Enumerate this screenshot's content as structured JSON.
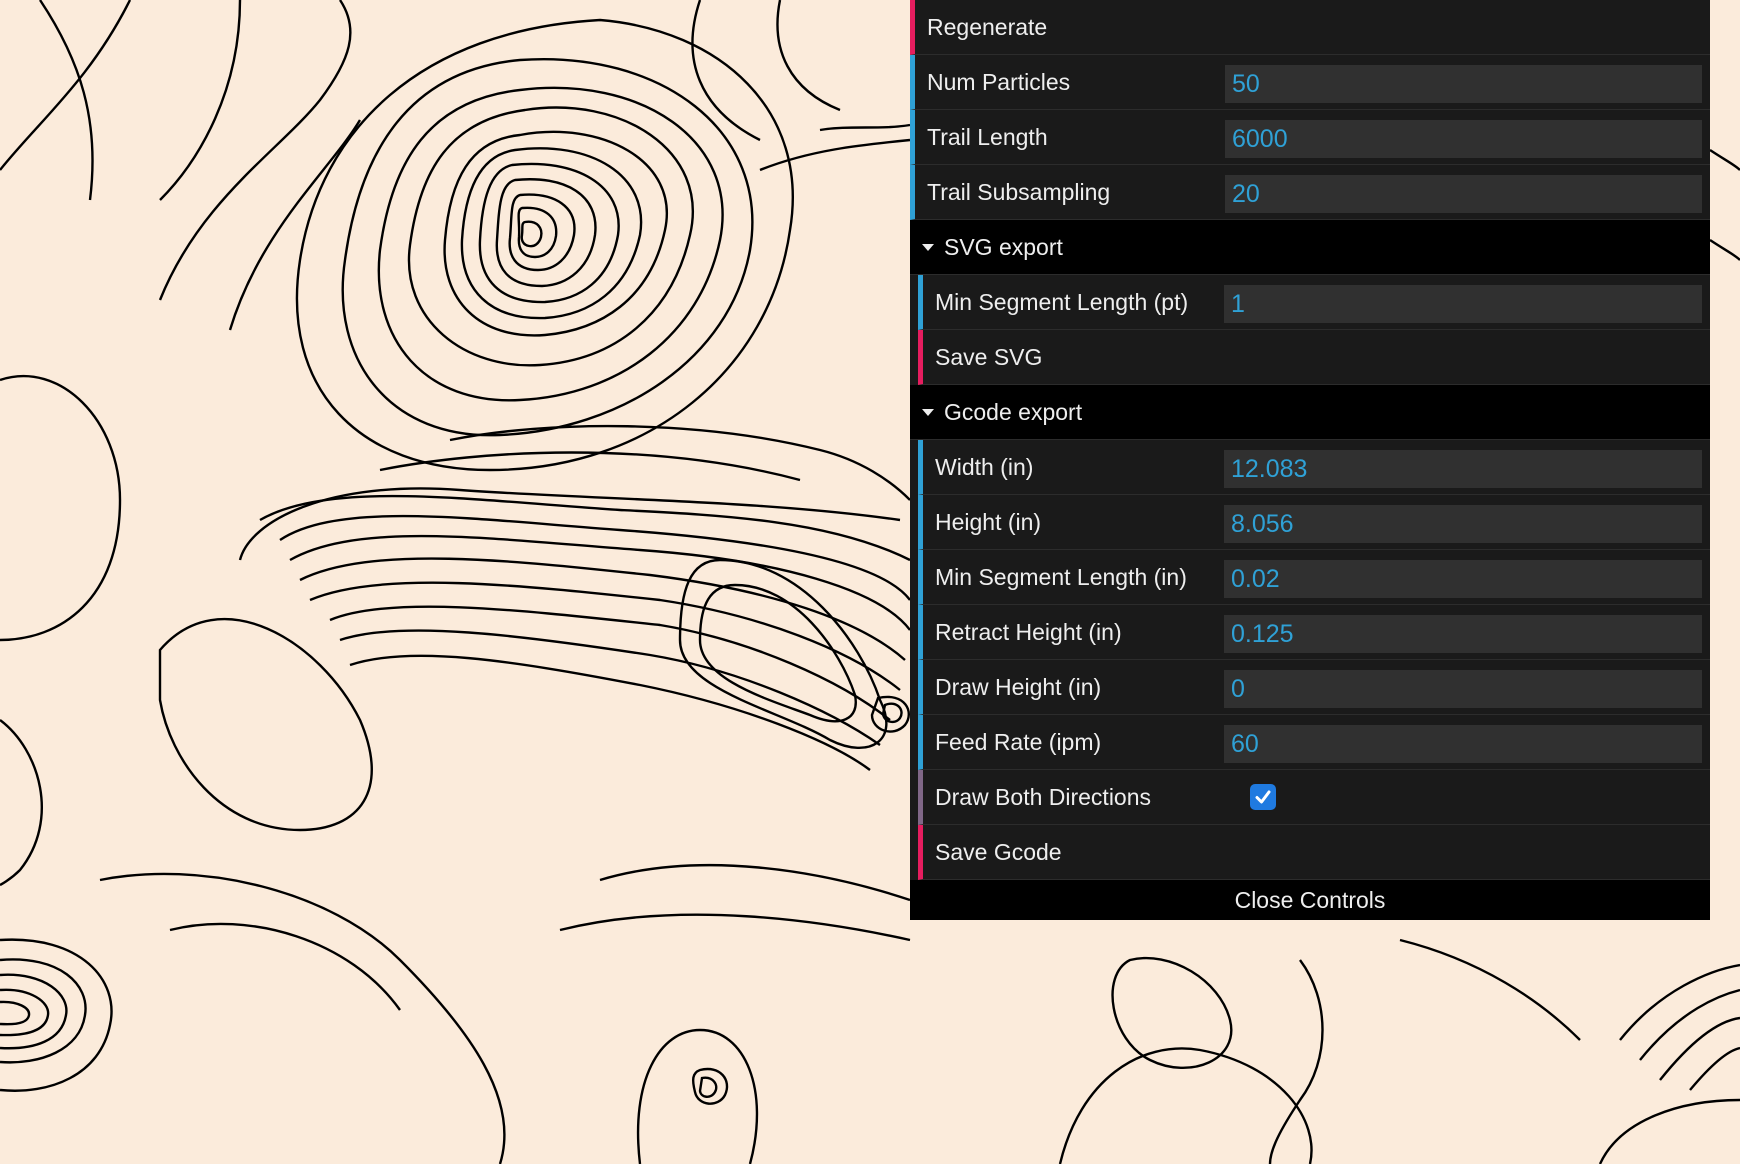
{
  "controls": {
    "regenerate_label": "Regenerate",
    "num_particles": {
      "label": "Num Particles",
      "value": "50"
    },
    "trail_length": {
      "label": "Trail Length",
      "value": "6000"
    },
    "trail_subsampling": {
      "label": "Trail Subsampling",
      "value": "20"
    }
  },
  "svg_export": {
    "title": "SVG export",
    "min_segment_length": {
      "label": "Min Segment Length (pt)",
      "value": "1"
    },
    "save_label": "Save SVG"
  },
  "gcode_export": {
    "title": "Gcode export",
    "width": {
      "label": "Width (in)",
      "value": "12.083"
    },
    "height": {
      "label": "Height (in)",
      "value": "8.056"
    },
    "min_segment_length": {
      "label": "Min Segment Length (in)",
      "value": "0.02"
    },
    "retract_height": {
      "label": "Retract Height (in)",
      "value": "0.125"
    },
    "draw_height": {
      "label": "Draw Height (in)",
      "value": "0"
    },
    "feed_rate": {
      "label": "Feed Rate (ipm)",
      "value": "60"
    },
    "draw_both_directions": {
      "label": "Draw Both Directions",
      "checked": true
    },
    "save_label": "Save Gcode"
  },
  "close_label": "Close Controls",
  "colors": {
    "background": "#fbebdb",
    "line": "#000000",
    "panel": "#1a1a1a",
    "number_accent": "#2fa1d6",
    "button_accent": "#e61d5f",
    "checkbox": "#1f7ae0"
  }
}
